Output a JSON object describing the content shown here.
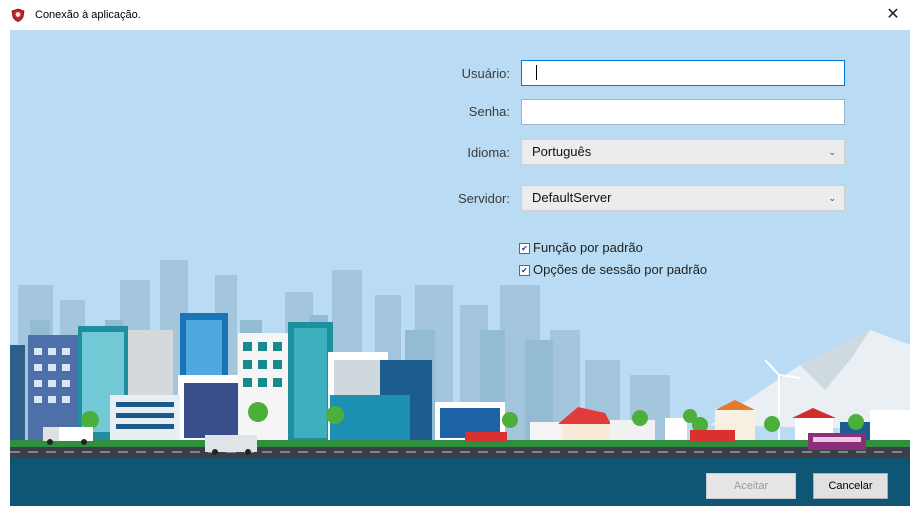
{
  "window": {
    "title": "Conexão à aplicação.",
    "close_glyph": "✕"
  },
  "form": {
    "user_label": "Usuário:",
    "user_value": "",
    "password_label": "Senha:",
    "password_value": "",
    "language_label": "Idioma:",
    "language_value": "Português",
    "server_label": "Servidor:",
    "server_value": "DefaultServer",
    "dropdown_icon": "chevron-down-icon",
    "default_role_label": "Função por padrão",
    "default_role_checked": true,
    "default_session_label": "Opções de sessão por padrão",
    "default_session_checked": true,
    "check_glyph": "✔"
  },
  "buttons": {
    "accept_label": "Aceitar",
    "accept_enabled": false,
    "cancel_label": "Cancelar"
  },
  "colors": {
    "sky": "#b9dcf4",
    "footer": "#0f5675",
    "focus_border": "#0078d7"
  }
}
